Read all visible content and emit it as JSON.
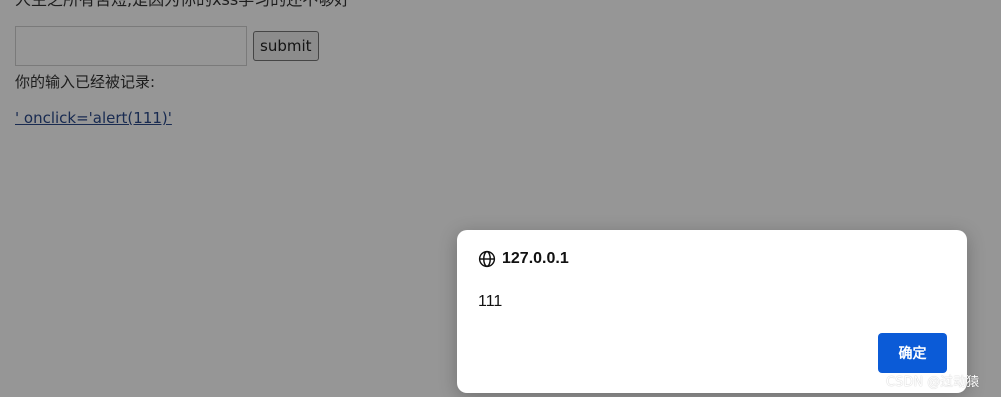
{
  "page": {
    "headline": "人生之所有苦短,是因为你的xss学习的还不够好",
    "input_value": "",
    "submit_label": "submit",
    "record_text": "你的输入已经被记录:",
    "record_link": "' onclick='alert(111)'"
  },
  "dialog": {
    "icon": "globe-icon",
    "origin": "127.0.0.1",
    "message": "111",
    "ok_label": "确定",
    "ok_color": "#0b5bd7"
  },
  "watermark": "CSDN @过动猿"
}
